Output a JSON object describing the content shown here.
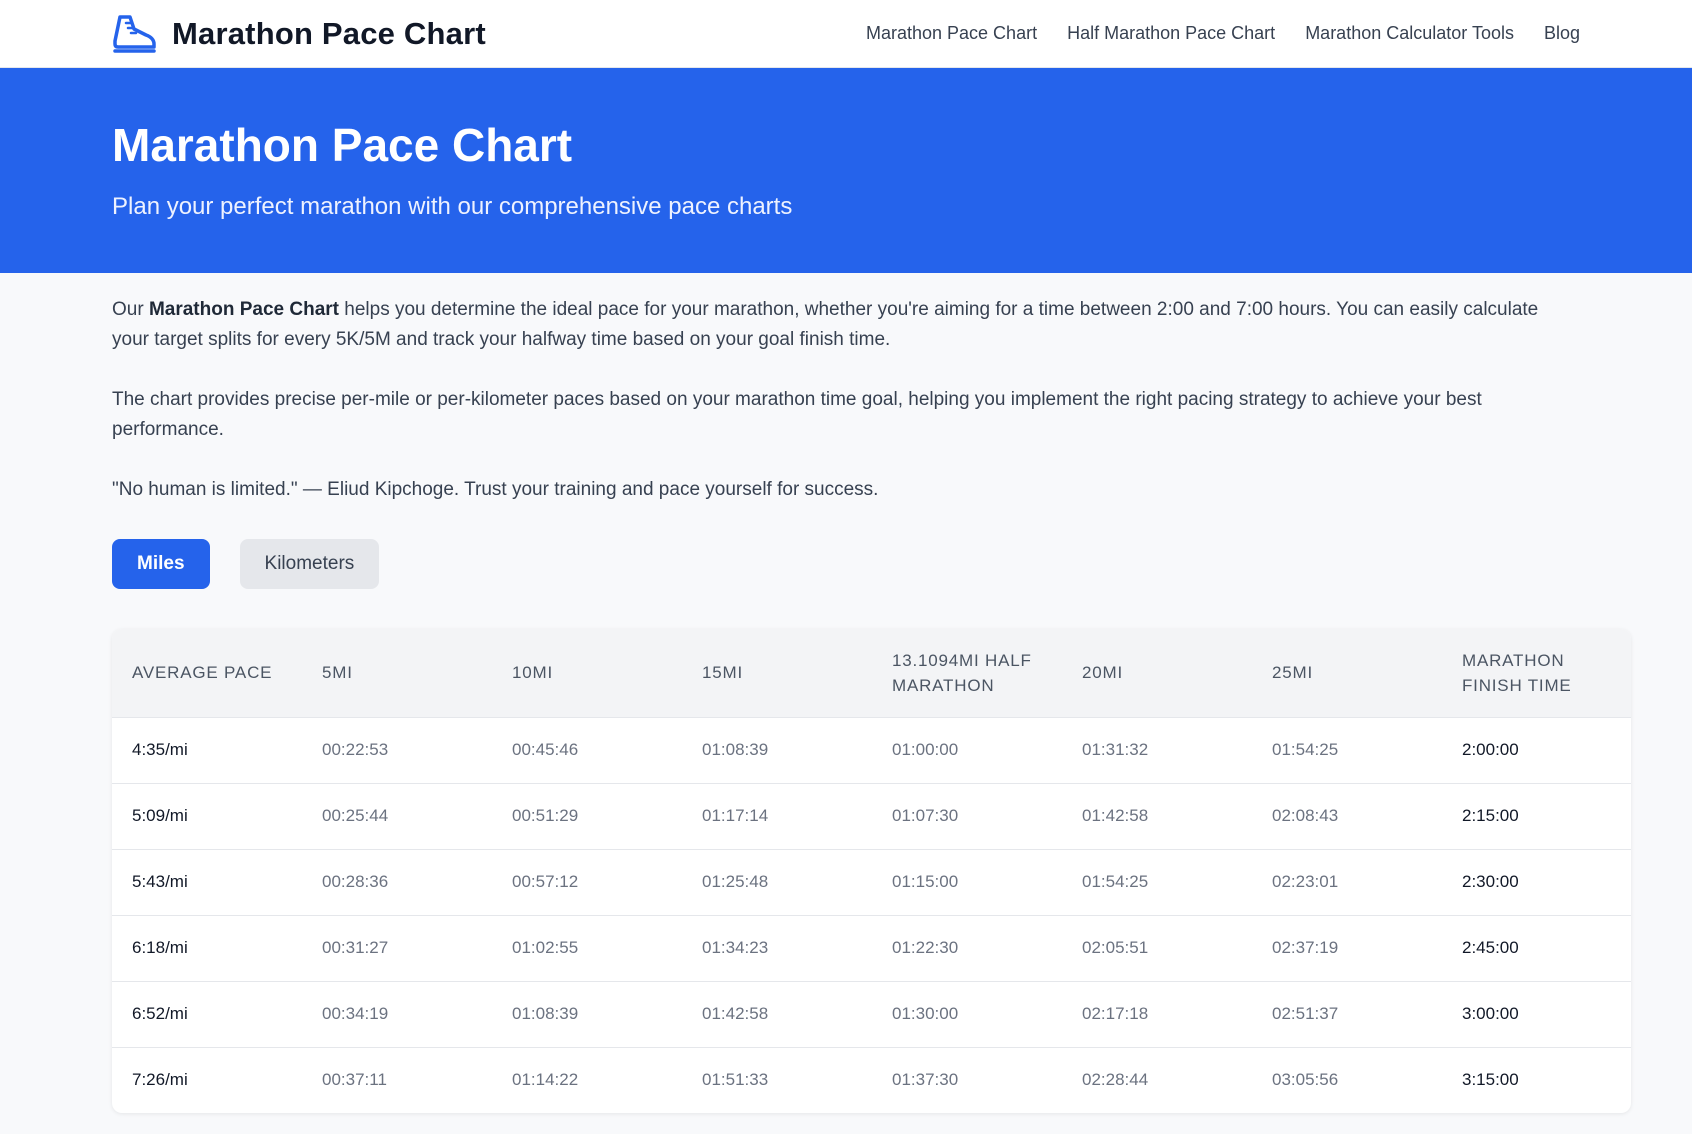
{
  "header": {
    "brand": "Marathon Pace Chart",
    "nav": [
      "Marathon Pace Chart",
      "Half Marathon Pace Chart",
      "Marathon Calculator Tools",
      "Blog"
    ]
  },
  "hero": {
    "title": "Marathon Pace Chart",
    "subtitle": "Plan your perfect marathon with our comprehensive pace charts"
  },
  "intro": {
    "p1_prefix": "Our ",
    "p1_bold": "Marathon Pace Chart",
    "p1_rest": " helps you determine the ideal pace for your marathon, whether you're aiming for a time between 2:00 and 7:00 hours. You can easily calculate your target splits for every 5K/5M and track your halfway time based on your goal finish time.",
    "p2": "The chart provides precise per-mile or per-kilometer paces based on your marathon time goal, helping you implement the right pacing strategy to achieve your best performance.",
    "p3": "\"No human is limited.\" — Eliud Kipchoge. Trust your training and pace yourself for success."
  },
  "unit_toggle": {
    "miles": "Miles",
    "kilometers": "Kilometers",
    "selected": "Miles"
  },
  "table": {
    "headers": [
      "AVERAGE PACE",
      "5MI",
      "10MI",
      "15MI",
      "13.1094MI HALF MARATHON",
      "20MI",
      "25MI",
      "MARATHON FINISH TIME"
    ],
    "rows": [
      [
        "4:35/mi",
        "00:22:53",
        "00:45:46",
        "01:08:39",
        "01:00:00",
        "01:31:32",
        "01:54:25",
        "2:00:00"
      ],
      [
        "5:09/mi",
        "00:25:44",
        "00:51:29",
        "01:17:14",
        "01:07:30",
        "01:42:58",
        "02:08:43",
        "2:15:00"
      ],
      [
        "5:43/mi",
        "00:28:36",
        "00:57:12",
        "01:25:48",
        "01:15:00",
        "01:54:25",
        "02:23:01",
        "2:30:00"
      ],
      [
        "6:18/mi",
        "00:31:27",
        "01:02:55",
        "01:34:23",
        "01:22:30",
        "02:05:51",
        "02:37:19",
        "2:45:00"
      ],
      [
        "6:52/mi",
        "00:34:19",
        "01:08:39",
        "01:42:58",
        "01:30:00",
        "02:17:18",
        "02:51:37",
        "3:00:00"
      ],
      [
        "7:26/mi",
        "00:37:11",
        "01:14:22",
        "01:51:33",
        "01:37:30",
        "02:28:44",
        "03:05:56",
        "3:15:00"
      ]
    ]
  }
}
